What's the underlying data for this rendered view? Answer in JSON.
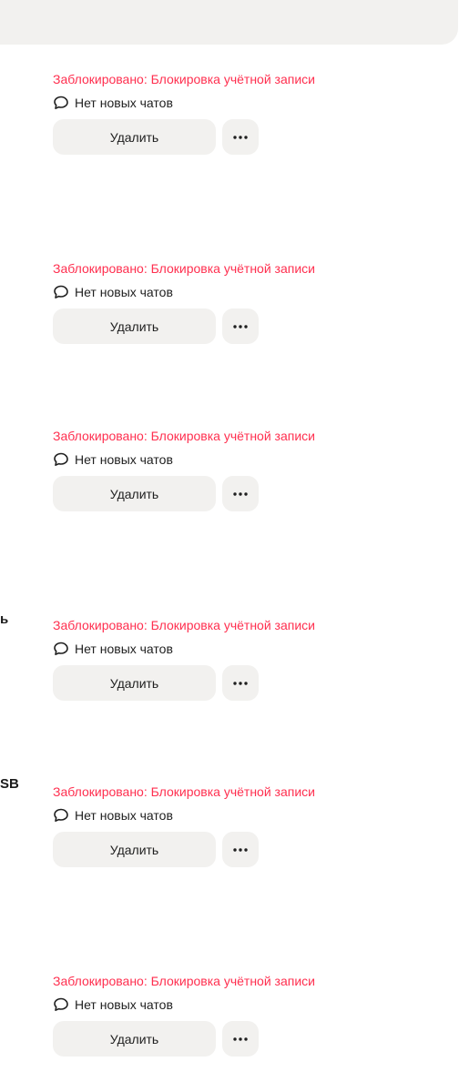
{
  "edge_fragments": {
    "row4": "ь",
    "row5": "SB"
  },
  "listings": [
    {
      "status": "Заблокировано: Блокировка учётной записи",
      "chats": "Нет новых чатов",
      "delete_label": "Удалить",
      "more_icon": "more-icon"
    },
    {
      "status": "Заблокировано: Блокировка учётной записи",
      "chats": "Нет новых чатов",
      "delete_label": "Удалить",
      "more_icon": "more-icon"
    },
    {
      "status": "Заблокировано: Блокировка учётной записи",
      "chats": "Нет новых чатов",
      "delete_label": "Удалить",
      "more_icon": "more-icon"
    },
    {
      "status": "Заблокировано: Блокировка учётной записи",
      "chats": "Нет новых чатов",
      "delete_label": "Удалить",
      "more_icon": "more-icon"
    },
    {
      "status": "Заблокировано: Блокировка учётной записи",
      "chats": "Нет новых чатов",
      "delete_label": "Удалить",
      "more_icon": "more-icon"
    },
    {
      "status": "Заблокировано: Блокировка учётной записи",
      "chats": "Нет новых чатов",
      "delete_label": "Удалить",
      "more_icon": "more-icon"
    }
  ],
  "colors": {
    "status_text": "#ff2f4f",
    "button_bg": "#f2f1ef",
    "text": "#1f1f1f"
  }
}
